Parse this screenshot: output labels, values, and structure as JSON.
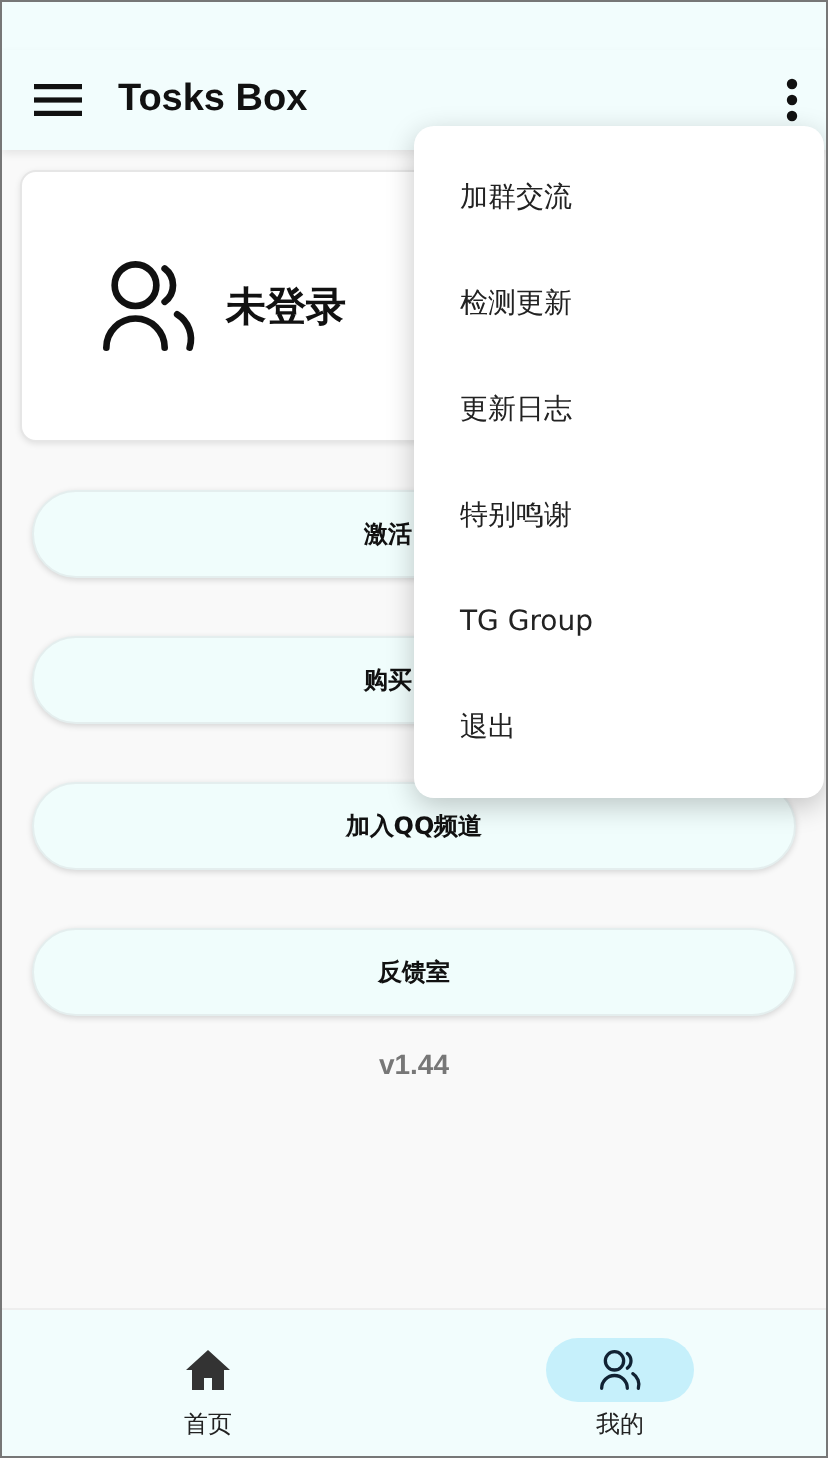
{
  "app_bar": {
    "title": "Tosks Box"
  },
  "profile": {
    "status": "未登录"
  },
  "buttons": [
    {
      "label": "激活"
    },
    {
      "label": "购买"
    },
    {
      "label": "加入QQ频道"
    },
    {
      "label": "反馈室"
    }
  ],
  "version": "v1.44",
  "menu": {
    "items": [
      "加群交流",
      "检测更新",
      "更新日志",
      "特别鸣谢",
      "TG Group",
      "退出"
    ]
  },
  "bottom_nav": [
    {
      "label": "首页",
      "kind": "home",
      "selected": false
    },
    {
      "label": "我的",
      "kind": "people",
      "selected": true
    }
  ]
}
